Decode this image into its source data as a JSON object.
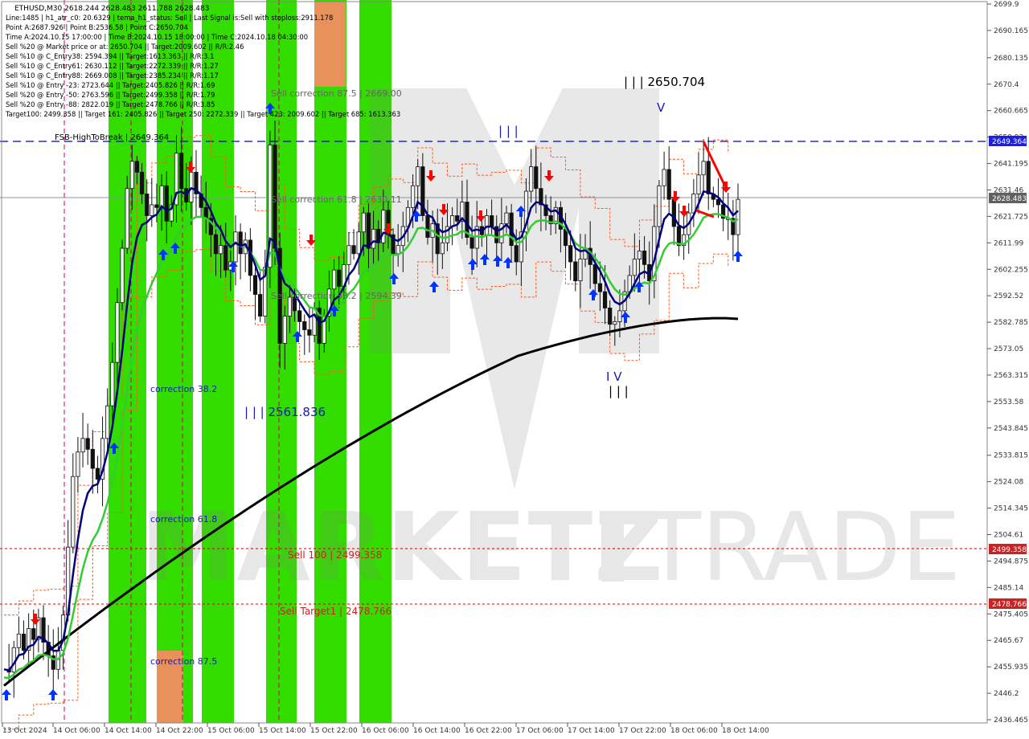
{
  "header": {
    "symbol_line": "ETHUSD,M30  2618.244 2628.483 2611.788 2628.483",
    "info_lines": [
      "Line:1485  |  h1_atr_c0: 20.6329  |  tema_h1_status: Sell  |  Last Signal is:Sell with stoploss:2911.178",
      "Point A:2687.926  |  Point B:2536.58  |  Point C:2650.704",
      "Time A:2024.10.15 17:00:00  |  Time B:2024.10.15 18:00:00  |  Time C:2024.10.18 04:30:00",
      "Sell %20 @ Market price or at: 2650.704  ||  Target:2009.602  ||  R/R:2.46",
      "Sell %10 @ C_Entry38: 2594.394  ||  Target:1613.363  ||  R/R:3.1",
      "Sell %10 @ C_Entry61: 2630.112  ||  Target:2272.339  ||  R/R:1.27",
      "Sell %10 @ C_Entry88: 2669.008  ||  Target:2385.234  ||  R/R:1.17",
      "Sell %10 @ Entry -23: 2723.644  ||  Target:2405.826  ||  R/R:1.69",
      "Sell %20 @ Entry -50: 2763.596  ||  Target:2499.358  ||  R/R:1.79",
      "Sell %20 @ Entry -88: 2822.019  ||  Target:2478.766  ||  R/R:3.85",
      "Target100: 2499.358  ||  Target 161: 2405.826  ||  Target 250: 2272.339  ||  Target 423: 2009.602  ||  Target 685: 1613.363"
    ]
  },
  "annotations": {
    "fsb": "FSB-HighToBreak  |  2649.364",
    "sell_corr_875": "Sell correction 87.5 | 2669.00",
    "sell_corr_618": "Sell correction 61.8 | 2630.11",
    "sell_corr_382": "Sell correction 38.2 | 2594.39",
    "sell_100": "Sell 100 | 2499.358",
    "sell_target1": "Sell Target1 | 2478.766",
    "corr_382": "correction 38.2",
    "corr_618": "correction 61.8",
    "corr_875": "correction 87.5",
    "wave_c": "| | | 2650.704",
    "wave_b": "| | | 2561.836",
    "lbl_iii_top": "| | |",
    "lbl_v_top": "V",
    "lbl_iv": "I V",
    "lbl_iii_bot": "| | |",
    "watermark_a": "MARKETZ",
    "watermark_b": "TRADE"
  },
  "price_tags": {
    "current": "2628.483",
    "fsb": "2649.364",
    "sell100": "2499.358",
    "target1": "2478.766"
  },
  "colors": {
    "background": "#ffffff",
    "green_zone": "#33dd00",
    "orange_zone": "#e8915a",
    "ma_fast": "#00007f",
    "ma_mid": "#33cc33",
    "ma_slow": "#000000",
    "buy_arrow": "#0033ff",
    "sell_arrow": "#ff0000",
    "dashed_level": "#0000cc",
    "red_level": "#cc0000",
    "tag_blue": "#1e1ee6",
    "tag_gray": "#606060",
    "tag_red": "#cc2222"
  },
  "chart_data": {
    "type": "candlestick",
    "symbol": "ETHUSD",
    "timeframe": "M30",
    "y_ticks": [
      2699.9,
      2690.165,
      2680.135,
      2670.4,
      2660.665,
      2650.93,
      2641.195,
      2631.46,
      2621.725,
      2611.99,
      2602.255,
      2592.52,
      2582.785,
      2573.05,
      2563.315,
      2553.58,
      2543.845,
      2533.815,
      2524.08,
      2514.345,
      2504.61,
      2494.875,
      2485.14,
      2475.405,
      2465.67,
      2455.935,
      2446.2,
      2436.465
    ],
    "x_labels": [
      "13 Oct 2024",
      "14 Oct 06:00",
      "14 Oct 14:00",
      "14 Oct 22:00",
      "15 Oct 06:00",
      "15 Oct 14:00",
      "15 Oct 22:00",
      "16 Oct 06:00",
      "16 Oct 14:00",
      "16 Oct 22:00",
      "17 Oct 06:00",
      "17 Oct 14:00",
      "17 Oct 22:00",
      "18 Oct 06:00",
      "18 Oct 14:00"
    ],
    "levels": [
      {
        "name": "FSB-HighToBreak",
        "value": 2649.364
      },
      {
        "name": "current",
        "value": 2628.483
      },
      {
        "name": "Sell 100",
        "value": 2499.358
      },
      {
        "name": "Sell Target1",
        "value": 2478.766
      }
    ],
    "ylim": [
      2436.465,
      2699.9
    ],
    "close_path": [
      2455,
      2454,
      2463,
      2468,
      2462,
      2470,
      2466,
      2474,
      2465,
      2460,
      2455,
      2462,
      2475,
      2500,
      2526,
      2535,
      2540,
      2536,
      2529,
      2525,
      2540,
      2552,
      2568,
      2590,
      2610,
      2632,
      2642,
      2638,
      2630,
      2622,
      2626,
      2625,
      2633,
      2620,
      2626,
      2645,
      2632,
      2627,
      2638,
      2630,
      2625,
      2621,
      2615,
      2608,
      2611,
      2602,
      2605,
      2616,
      2608,
      2613,
      2600,
      2593,
      2585,
      2603,
      2648,
      2610,
      2575,
      2585,
      2592,
      2587,
      2583,
      2580,
      2578,
      2588,
      2575,
      2585,
      2595,
      2602,
      2596,
      2604,
      2611,
      2608,
      2616,
      2623,
      2610,
      2617,
      2612,
      2624,
      2615,
      2608,
      2611,
      2618,
      2625,
      2633,
      2640,
      2622,
      2614,
      2619,
      2608,
      2612,
      2618,
      2622,
      2620,
      2627,
      2614,
      2610,
      2618,
      2615,
      2622,
      2618,
      2612,
      2619,
      2623,
      2611,
      2605,
      2616,
      2631,
      2640,
      2632,
      2626,
      2622,
      2619,
      2625,
      2617,
      2611,
      2605,
      2598,
      2606,
      2610,
      2604,
      2597,
      2594,
      2588,
      2582,
      2583,
      2587,
      2594,
      2600,
      2606,
      2609,
      2604,
      2598,
      2618,
      2633,
      2639,
      2628,
      2618,
      2611,
      2615,
      2623,
      2630,
      2637,
      2642,
      2630,
      2628,
      2626,
      2621,
      2621,
      2615,
      2628
    ]
  }
}
